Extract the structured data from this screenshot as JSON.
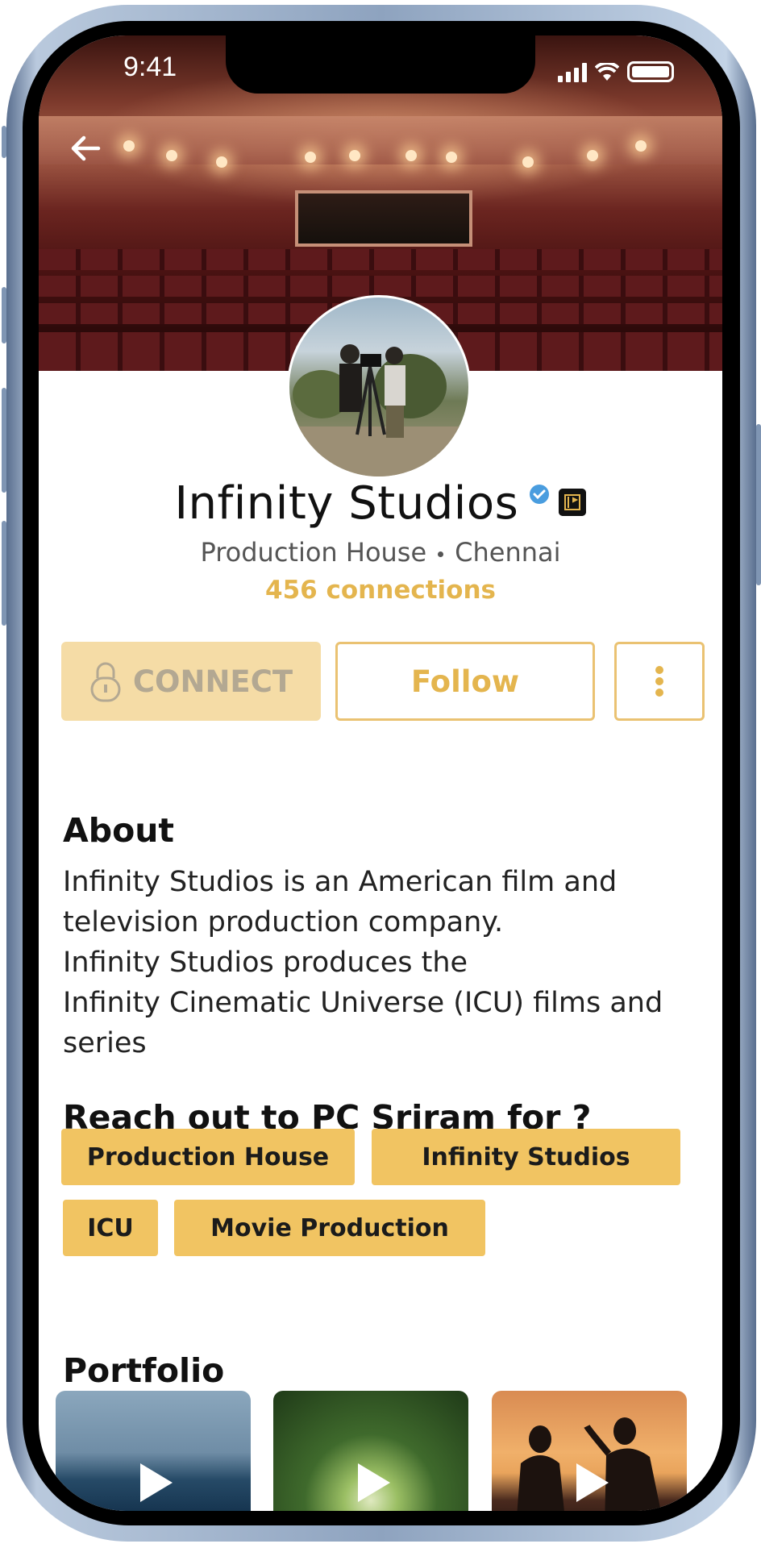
{
  "status_bar": {
    "time": "9:41"
  },
  "profile": {
    "name": "Infinity Studios",
    "category": "Production House",
    "location": "Chennai",
    "connections": "456 connections"
  },
  "actions": {
    "connect_label": "CONNECT",
    "follow_label": "Follow"
  },
  "about": {
    "heading": "About",
    "lines": [
      "Infinity Studios is an American film and",
      "television production company.",
      "Infinity Studios produces the",
      "Infinity Cinematic Universe (ICU) films and",
      "series"
    ]
  },
  "reach_out": {
    "heading": "Reach out to PC Sriram for ?",
    "tags": [
      "Production House",
      "Infinity Studios",
      "ICU",
      "Movie Production"
    ]
  },
  "portfolio": {
    "heading": "Portfolio",
    "items": [
      {
        "icon": "play-icon"
      },
      {
        "icon": "play-icon"
      },
      {
        "icon": "play-icon"
      }
    ]
  },
  "colors": {
    "accent": "#e4b54e",
    "tag_bg": "#f1c462",
    "connect_disabled_bg": "#f5dca6"
  }
}
